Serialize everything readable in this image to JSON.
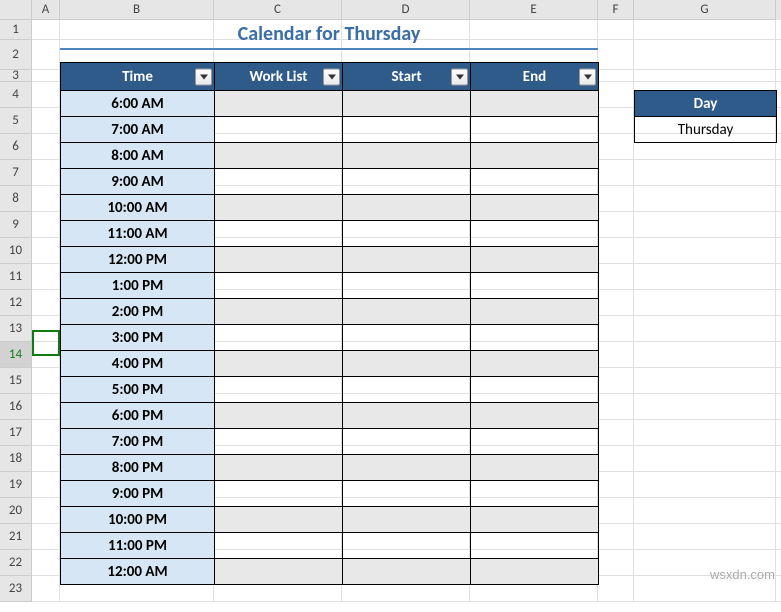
{
  "columns": [
    "A",
    "B",
    "C",
    "D",
    "E",
    "F",
    "G"
  ],
  "row_numbers": [
    1,
    2,
    3,
    4,
    5,
    6,
    7,
    8,
    9,
    10,
    11,
    12,
    13,
    14,
    15,
    16,
    17,
    18,
    19,
    20,
    21,
    22,
    23
  ],
  "title": "Calendar for Thursday",
  "headers": {
    "time": "Time",
    "work_list": "Work List",
    "start": "Start",
    "end": "End"
  },
  "times": [
    "6:00 AM",
    "7:00 AM",
    "8:00 AM",
    "9:00 AM",
    "10:00 AM",
    "11:00 AM",
    "12:00 PM",
    "1:00 PM",
    "2:00 PM",
    "3:00 PM",
    "4:00 PM",
    "5:00 PM",
    "6:00 PM",
    "7:00 PM",
    "8:00 PM",
    "9:00 PM",
    "10:00 PM",
    "11:00 PM",
    "12:00 AM"
  ],
  "day": {
    "header": "Day",
    "value": "Thursday"
  },
  "selected_row": 14,
  "watermark": "wsxdn.com",
  "chart_data": {
    "type": "table",
    "title": "Calendar for Thursday",
    "columns": [
      "Time",
      "Work List",
      "Start",
      "End"
    ],
    "rows": [
      [
        "6:00 AM",
        "",
        "",
        ""
      ],
      [
        "7:00 AM",
        "",
        "",
        ""
      ],
      [
        "8:00 AM",
        "",
        "",
        ""
      ],
      [
        "9:00 AM",
        "",
        "",
        ""
      ],
      [
        "10:00 AM",
        "",
        "",
        ""
      ],
      [
        "11:00 AM",
        "",
        "",
        ""
      ],
      [
        "12:00 PM",
        "",
        "",
        ""
      ],
      [
        "1:00 PM",
        "",
        "",
        ""
      ],
      [
        "2:00 PM",
        "",
        "",
        ""
      ],
      [
        "3:00 PM",
        "",
        "",
        ""
      ],
      [
        "4:00 PM",
        "",
        "",
        ""
      ],
      [
        "5:00 PM",
        "",
        "",
        ""
      ],
      [
        "6:00 PM",
        "",
        "",
        ""
      ],
      [
        "7:00 PM",
        "",
        "",
        ""
      ],
      [
        "8:00 PM",
        "",
        "",
        ""
      ],
      [
        "9:00 PM",
        "",
        "",
        ""
      ],
      [
        "10:00 PM",
        "",
        "",
        ""
      ],
      [
        "11:00 PM",
        "",
        "",
        ""
      ],
      [
        "12:00 AM",
        "",
        "",
        ""
      ]
    ],
    "side_table": {
      "Day": "Thursday"
    }
  }
}
